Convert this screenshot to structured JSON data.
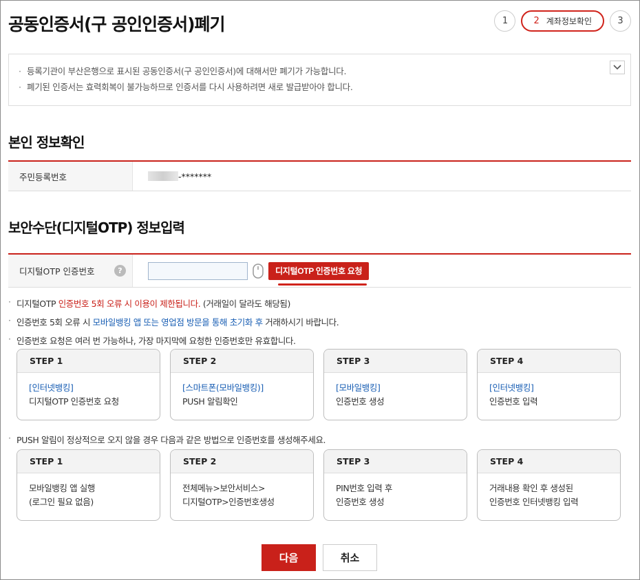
{
  "page": {
    "title": "공동인증서(구 공인인증서)폐기"
  },
  "progress": {
    "step1": "1",
    "step2_num": "2",
    "step2_label": "계좌정보확인",
    "step3": "3"
  },
  "notice": {
    "items": [
      "등록기관이 부산은행으로 표시된 공동인증서(구 공인인증서)에 대해서만 폐기가 가능합니다.",
      "폐기된 인증서는 효력회복이 불가능하므로 인증서를 다시 사용하려면 새로 발급받아야 합니다."
    ]
  },
  "identity": {
    "section_title": "본인 정보확인",
    "rrn_label": "주민등록번호",
    "rrn_value": "-*******"
  },
  "otp": {
    "section_title": "보안수단(디지털OTP) 정보입력",
    "label": "디지털OTP 인증번호",
    "input_value": "",
    "request_button": "디지털OTP 인증번호 요청"
  },
  "info": {
    "line1_a": "디지털OTP",
    "line1_b": "인증번호 5회 오류 시 이용이 제한됩니다.",
    "line1_c": "(거래일이 달라도 해당됨)",
    "line2_a": "인증번호 5회 오류 시",
    "line2_b": "모바일뱅킹 앱 또는 영업점 방문을 통해 초기화 후",
    "line2_c": "거래하시기 바랍니다.",
    "line3": "인증번호 요청은 여러 번 가능하나, 가장 마지막에 요청한 인증번호만 유효합니다.",
    "line4": "PUSH 알림이 정상적으로 오지 않을 경우 다음과 같은 방법으로 인증번호를 생성해주세요."
  },
  "steps_a": [
    {
      "head": "STEP 1",
      "line1": "[인터넷뱅킹]",
      "line2": "디지털OTP 인증번호 요청"
    },
    {
      "head": "STEP 2",
      "line1": "[스마트폰(모바일뱅킹)]",
      "line2": "PUSH 알림확인"
    },
    {
      "head": "STEP 3",
      "line1": "[모바일뱅킹]",
      "line2": "인증번호 생성"
    },
    {
      "head": "STEP 4",
      "line1": "[인터넷뱅킹]",
      "line2": "인증번호 입력"
    }
  ],
  "steps_b": [
    {
      "head": "STEP 1",
      "line1": "모바일뱅킹 앱 실행",
      "line2": "(로그인 필요 없음)"
    },
    {
      "head": "STEP 2",
      "line1": "전체메뉴>보안서비스>",
      "line2": "디지털OTP>인증번호생성"
    },
    {
      "head": "STEP 3",
      "line1": "PIN번호 입력 후",
      "line2": "인증번호 생성"
    },
    {
      "head": "STEP 4",
      "line1": "거래내용 확인 후 생성된",
      "line2": "인증번호 인터넷뱅킹 입력"
    }
  ],
  "buttons": {
    "next": "다음",
    "cancel": "취소"
  },
  "colors": {
    "accent": "#c9211a",
    "link": "#1a5fb4"
  }
}
